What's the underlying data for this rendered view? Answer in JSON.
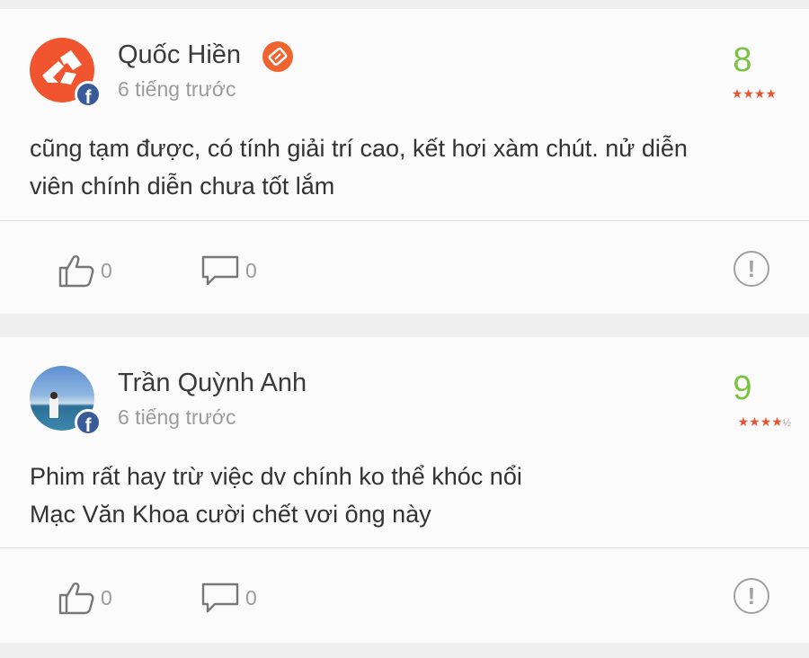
{
  "reviews": [
    {
      "author": "Quốc Hiền",
      "time": "6 tiếng trước",
      "score": "8",
      "stars": "★★★★",
      "stars_half": "",
      "text_line1": "cũng tạm được, có tính giải trí cao, kết hơi xàm chút. nử diễn",
      "text_line2": "viên chính diễn chưa tốt lắm",
      "likes": "0",
      "comments": "0"
    },
    {
      "author": "Trần Quỳnh Anh",
      "time": "6 tiếng trước",
      "score": "9",
      "stars": "★★★★",
      "stars_half": "½",
      "text_line1": "Phim rất hay trừ việc dv chính ko thể khóc nổi",
      "text_line2": "Mạc Văn Khoa cười chết vơi ông này",
      "likes": "0",
      "comments": "0"
    }
  ],
  "badge_letter": "f",
  "report_symbol": "!",
  "colors": {
    "score": "#7cc241",
    "stars": "#e9542e",
    "facebook": "#3b5a9a",
    "brand_avatar": "#f0552f"
  },
  "icons": [
    "facebook-icon",
    "verified-badge-icon",
    "thumbs-up-icon",
    "comment-icon",
    "report-icon"
  ]
}
